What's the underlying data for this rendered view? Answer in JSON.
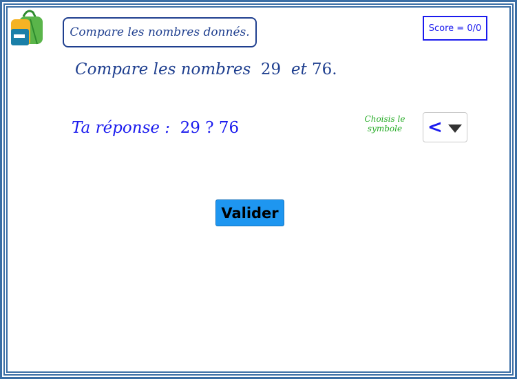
{
  "header": {
    "title": "Compare les nombres donnés.",
    "score": "Score = 0/0"
  },
  "question": {
    "prefix": "Compare les nombres",
    "first_number": "29",
    "connector": "et",
    "second_number": "76."
  },
  "answer": {
    "label": "Ta réponse :",
    "expression": "29 ? 76"
  },
  "symbol_picker": {
    "hint": "Choisis le symbole",
    "selected": "<"
  },
  "actions": {
    "validate_label": "Valider"
  },
  "colors": {
    "frame": "#3a6ea5",
    "title": "#1f3f8f",
    "text_blue": "#1a1aee",
    "hint_green": "#22aa22",
    "button": "#1e96f0"
  },
  "icons": {
    "app_logo": "backpack-icon",
    "dropdown": "caret-down-icon"
  }
}
